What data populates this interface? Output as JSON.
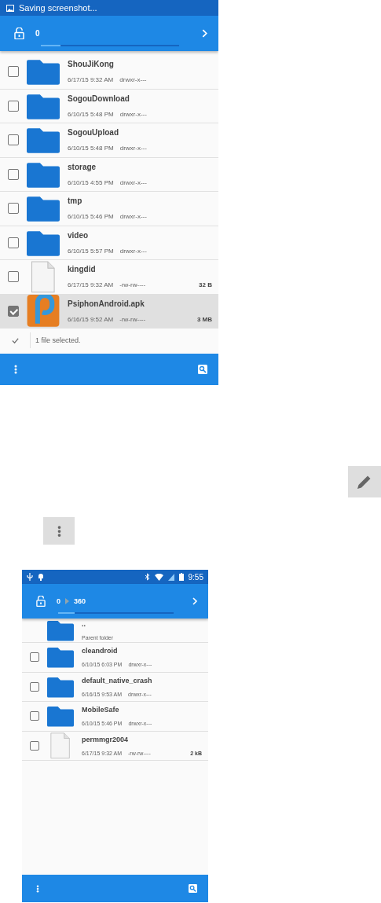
{
  "screenshot_1": {
    "notification": "Saving screenshot...",
    "breadcrumb": [
      "0"
    ],
    "rows": [
      {
        "kind": "folder",
        "name": "ShouJiKong",
        "date": "6/17/15 9:32 AM",
        "permissions": "drwxr-x---",
        "checked": false
      },
      {
        "kind": "folder",
        "name": "SogouDownload",
        "date": "6/10/15 5:48 PM",
        "permissions": "drwxr-x---",
        "checked": false
      },
      {
        "kind": "folder",
        "name": "SogouUpload",
        "date": "6/10/15 5:48 PM",
        "permissions": "drwxr-x---",
        "checked": false
      },
      {
        "kind": "folder",
        "name": "storage",
        "date": "6/10/15 4:55 PM",
        "permissions": "drwxr-x---",
        "checked": false
      },
      {
        "kind": "folder",
        "name": "tmp",
        "date": "6/10/15 5:46 PM",
        "permissions": "drwxr-x---",
        "checked": false
      },
      {
        "kind": "folder",
        "name": "video",
        "date": "6/10/15 5:57 PM",
        "permissions": "drwxr-x---",
        "checked": false
      },
      {
        "kind": "file",
        "name": "kingdid",
        "date": "6/17/15 9:32 AM",
        "permissions": "-rw-rw----",
        "size": "32 B",
        "checked": false
      },
      {
        "kind": "apk",
        "name": "PsiphonAndroid.apk",
        "date": "6/16/15 9:52 AM",
        "permissions": "-rw-rw----",
        "size": "3 MB",
        "checked": true
      }
    ],
    "selection_bar": "1 file selected."
  },
  "screenshot_2": {
    "status_time": "9:55",
    "breadcrumb": [
      "0",
      "360"
    ],
    "rows": [
      {
        "kind": "parent",
        "name": "..",
        "date": "Parent folder"
      },
      {
        "kind": "folder",
        "name": "cleandroid",
        "date": "6/10/15 6:03 PM",
        "permissions": "drwxr-x---",
        "checked": false
      },
      {
        "kind": "folder",
        "name": "default_native_crash",
        "date": "6/16/15 9:53 AM",
        "permissions": "drwxr-x---",
        "checked": false
      },
      {
        "kind": "folder",
        "name": "MobileSafe",
        "date": "6/10/15 5:46 PM",
        "permissions": "drwxr-x---",
        "checked": false
      },
      {
        "kind": "file",
        "name": "permmgr2004",
        "date": "6/17/15 9:32 AM",
        "permissions": "-rw-rw----",
        "size": "2 kB",
        "checked": false
      }
    ]
  }
}
